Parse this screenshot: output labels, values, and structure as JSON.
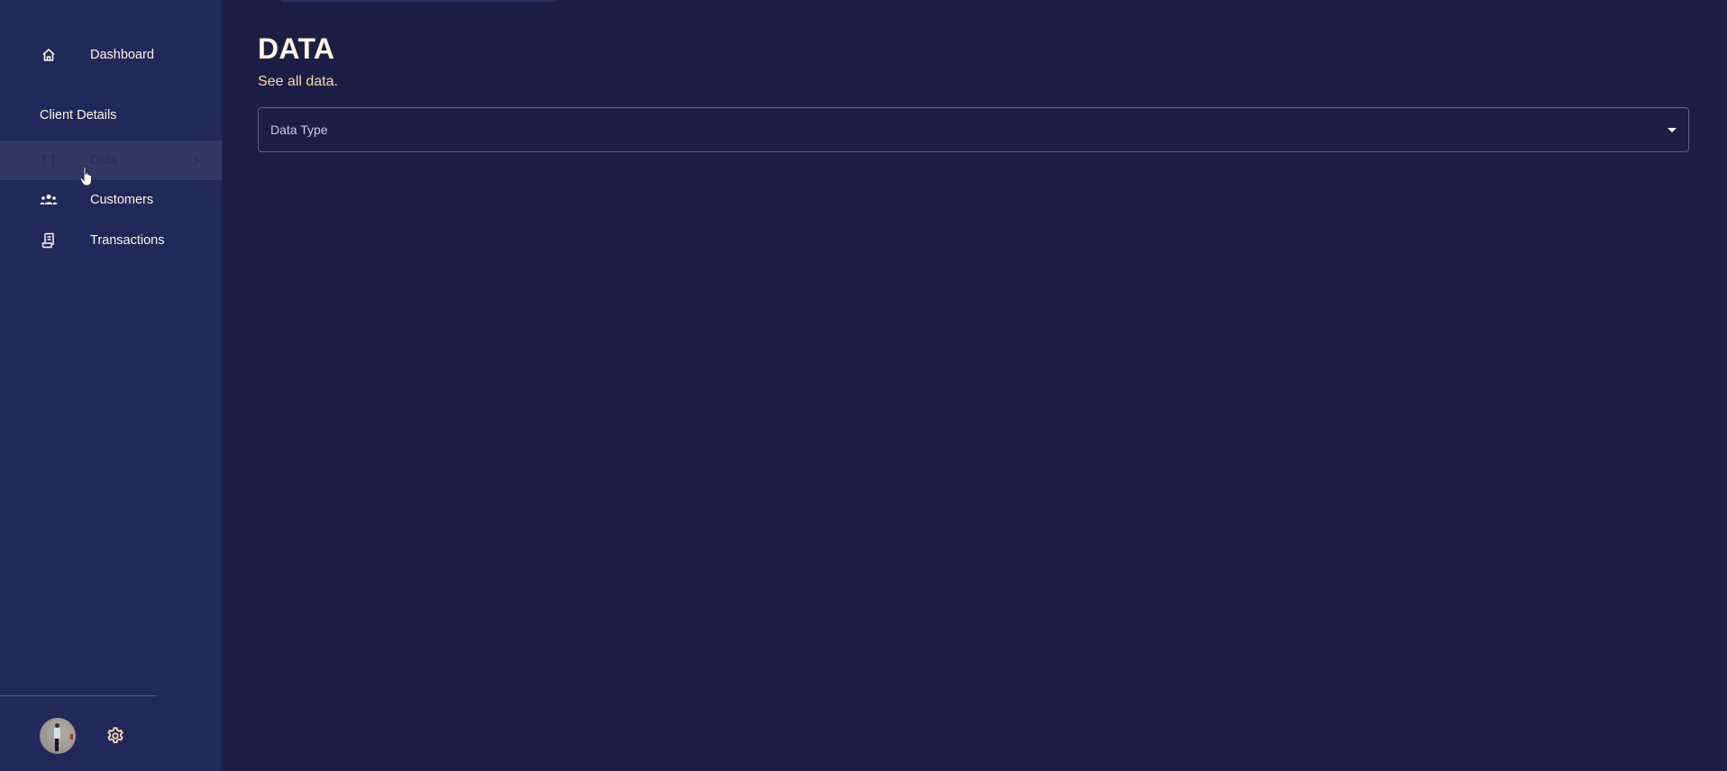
{
  "sidebar": {
    "items": [
      {
        "label": "Dashboard",
        "icon": "home-icon"
      },
      {
        "label": "Data",
        "icon": "brackets-icon",
        "active": true,
        "has_chevron": true
      },
      {
        "label": "Customers",
        "icon": "people-icon"
      },
      {
        "label": "Transactions",
        "icon": "receipt-icon"
      }
    ],
    "section_label": "Client Details",
    "data_icon_glyph": "[ ]"
  },
  "header": {
    "title": "DATA",
    "subtitle": "See all data."
  },
  "filter": {
    "label": "Data Type",
    "selected_value": ""
  },
  "colors": {
    "sidebar_bg": "#21285a",
    "main_bg": "#1b1f45",
    "text_primary": "#fff5e1",
    "text_accent": "#ffd9a8",
    "active_item_bg": "#323866"
  }
}
